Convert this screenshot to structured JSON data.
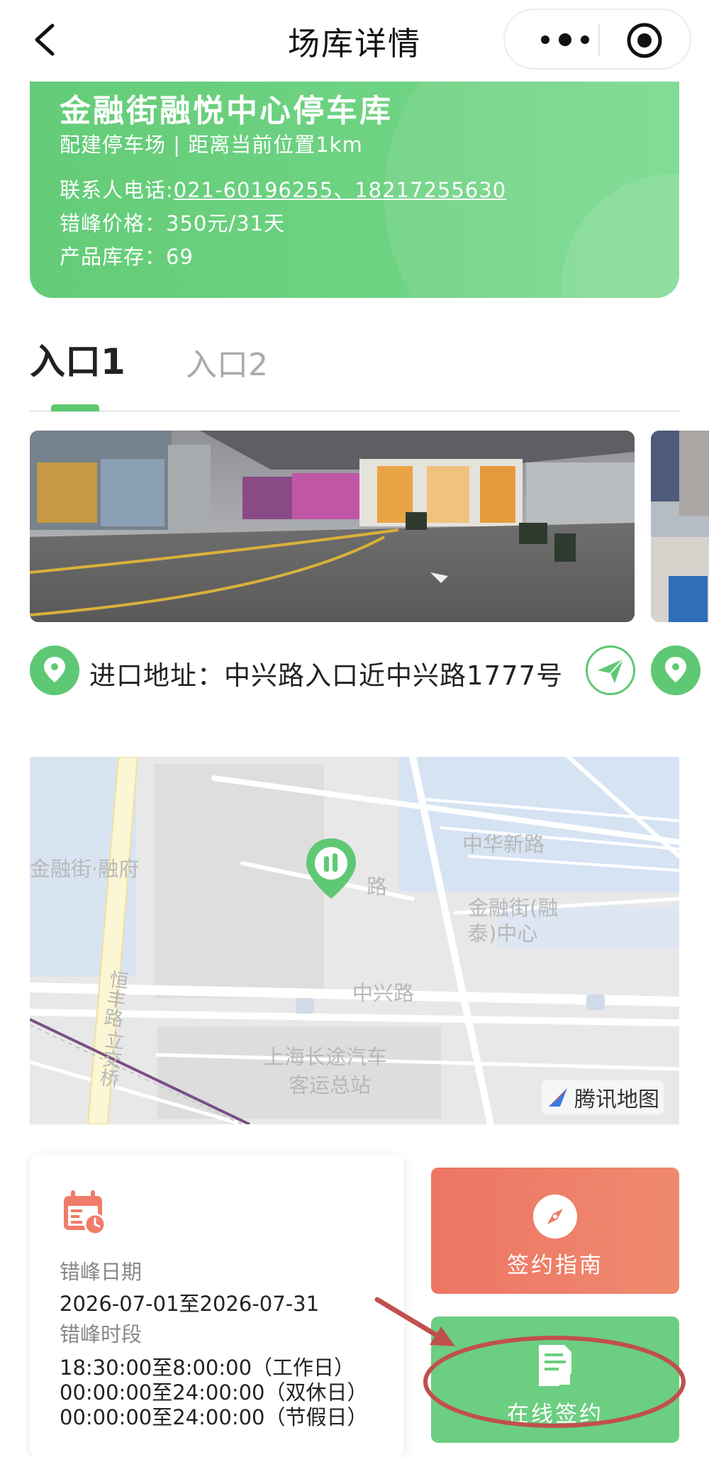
{
  "nav": {
    "title": "场库详情"
  },
  "lot": {
    "name": "金融街融悦中心停车库",
    "subtitle": "配建停车场 | 距离当前位置1km",
    "contact_label": "联系人电话:",
    "contact_phone": "021-60196255、18217255630",
    "price_label": "错峰价格：",
    "price_value": "350元/31天",
    "stock_label": "产品库存：",
    "stock_value": "69"
  },
  "tabs": [
    {
      "label": "入口1",
      "active": true
    },
    {
      "label": "入口2",
      "active": false
    }
  ],
  "entrance": {
    "address": "进口地址：中兴路入口近中兴路1777号"
  },
  "map": {
    "labels": [
      "金融街·融府",
      "中华新路",
      "金融街(融",
      "泰)中心",
      "中兴路",
      "恒丰路",
      "立交桥",
      "上海长途汽车",
      "客运总站",
      "路"
    ],
    "brand": "腾讯地图"
  },
  "schedule": {
    "date_label": "错峰日期",
    "date_value": "2026-07-01至2026-07-31",
    "time_label": "错峰时段",
    "time_values": [
      "18:30:00至8:00:00（工作日）",
      "00:00:00至24:00:00（双休日）",
      "00:00:00至24:00:00（节假日）"
    ]
  },
  "actions": {
    "guide_label": "签约指南",
    "sign_label": "在线签约"
  },
  "colors": {
    "brand_green": "#5fc874",
    "guide_orange": "#ee7563",
    "annotation_red": "#c0504d"
  },
  "icons": [
    "back-chevron-icon",
    "more-icon",
    "close-target-icon",
    "location-pin-icon",
    "navigate-arrow-icon",
    "calendar-icon",
    "compass-icon",
    "document-icon"
  ]
}
